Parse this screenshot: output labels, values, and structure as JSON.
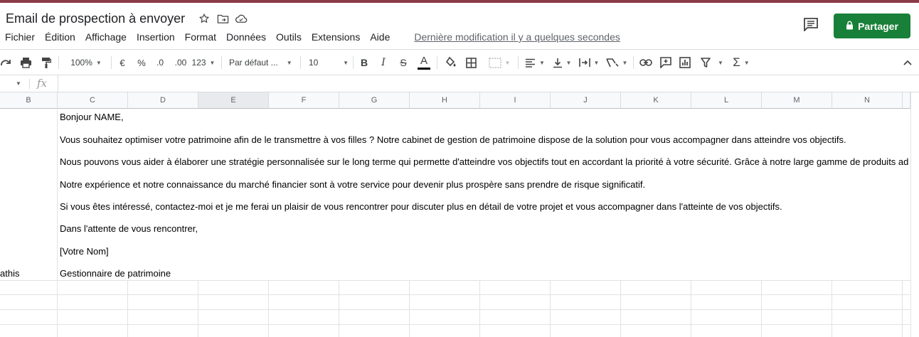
{
  "document": {
    "title": "Email de prospection à envoyer",
    "last_modified": "Dernière modification il y a quelques secondes"
  },
  "menu": [
    "Fichier",
    "Édition",
    "Affichage",
    "Insertion",
    "Format",
    "Données",
    "Outils",
    "Extensions",
    "Aide"
  ],
  "share": {
    "label": "Partager"
  },
  "toolbar": {
    "zoom": "100%",
    "currency": "€",
    "percent": "%",
    "decrease_decimals": ".0",
    "increase_decimals": ".00",
    "more_formats": "123",
    "font": "Par défaut ...",
    "font_size": "10",
    "bold": "B",
    "italic": "I",
    "strike": "S",
    "text_color": "A",
    "text_color_underline": "#000000"
  },
  "formula_bar": {
    "fx": "fx"
  },
  "columns": [
    "B",
    "C",
    "D",
    "E",
    "F",
    "G",
    "H",
    "I",
    "J",
    "K",
    "L",
    "M",
    "N"
  ],
  "selected_column": "E",
  "cells": {
    "col_c_lines": [
      "Bonjour NAME,",
      "Vous souhaitez optimiser votre patrimoine afin de le transmettre à vos filles ? Notre cabinet de gestion de patrimoine dispose de la solution pour vous accompagner dans atteindre vos objectifs.",
      "Nous pouvons vous aider à élaborer une stratégie personnalisée sur le long terme qui permette d'atteindre vos objectifs tout en accordant la priorité à votre sécurité. Grâce à notre large gamme de produits ad",
      "Notre expérience et notre connaissance du marché financier sont à votre service pour devenir plus prospère sans prendre de risque significatif.",
      "Si vous êtes intéressé, contactez-moi et je me ferai un plaisir de vous rencontrer pour discuter plus en détail de votre projet et vous accompagner dans l'atteinte de vos objectifs.",
      "Dans l'attente de vous rencontrer,",
      "[Votre Nom]",
      "Gestionnaire de patrimoine"
    ],
    "col_a_last": "athis"
  },
  "colors": {
    "accent_top": "#8b3a48",
    "share_green": "#188038"
  }
}
